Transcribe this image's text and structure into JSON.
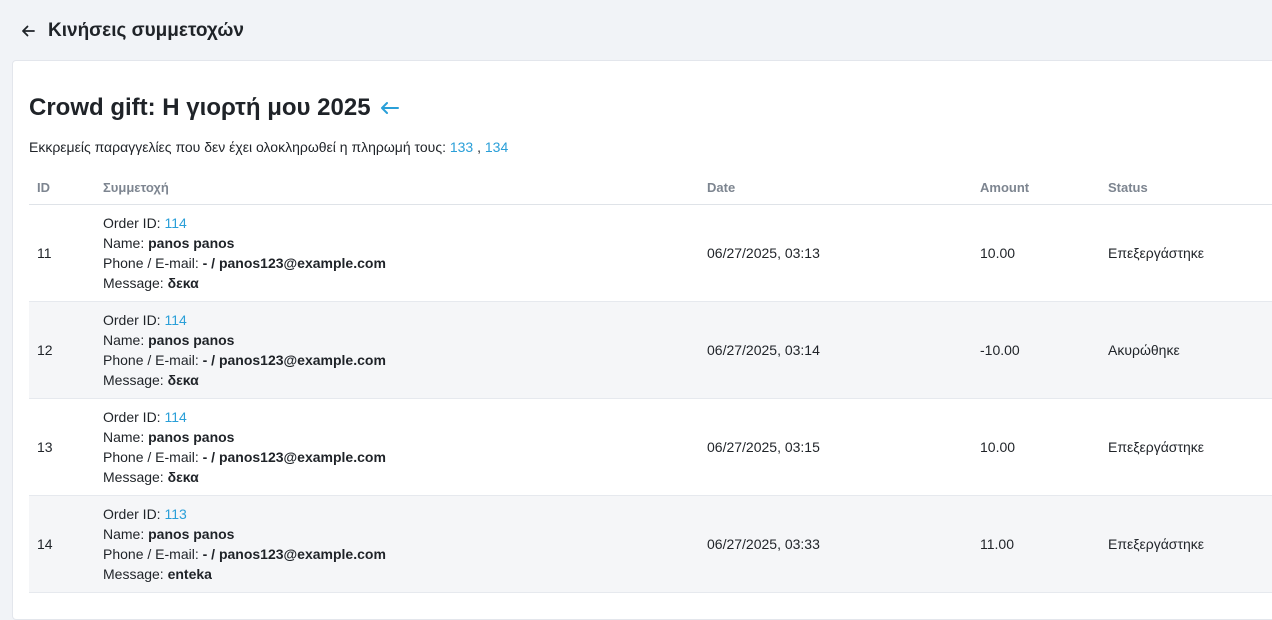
{
  "header": {
    "title": "Κινήσεις συμμετοχών"
  },
  "campaign": {
    "title": "Crowd gift: Η γιορτή μου 2025",
    "pending_text": "Εκκρεμείς παραγγελίες που δεν έχει ολοκληρωθεί η πληρωμή τους:",
    "pending_orders": [
      "133",
      "134"
    ],
    "pending_separator": ","
  },
  "table": {
    "columns": [
      "ID",
      "Συμμετοχή",
      "Date",
      "Amount",
      "Status"
    ],
    "labels": {
      "order_id": "Order ID:",
      "name": "Name:",
      "contact": "Phone / E-mail:",
      "message": "Message:"
    },
    "rows": [
      {
        "id": "11",
        "order_id": "114",
        "name": "panos panos",
        "contact": "- / panos123@example.com",
        "message": "δεκα",
        "date": "06/27/2025, 03:13",
        "amount": "10.00",
        "status": "Επεξεργάστηκε"
      },
      {
        "id": "12",
        "order_id": "114",
        "name": "panos panos",
        "contact": "- / panos123@example.com",
        "message": "δεκα",
        "date": "06/27/2025, 03:14",
        "amount": "-10.00",
        "status": "Ακυρώθηκε"
      },
      {
        "id": "13",
        "order_id": "114",
        "name": "panos panos",
        "contact": "- / panos123@example.com",
        "message": "δεκα",
        "date": "06/27/2025, 03:15",
        "amount": "10.00",
        "status": "Επεξεργάστηκε"
      },
      {
        "id": "14",
        "order_id": "113",
        "name": "panos panos",
        "contact": "- / panos123@example.com",
        "message": "enteka",
        "date": "06/27/2025, 03:33",
        "amount": "11.00",
        "status": "Επεξεργάστηκε"
      }
    ]
  },
  "icons": {
    "back": "arrow-left-icon",
    "heading_link": "arrow-left-icon"
  },
  "colors": {
    "link": "#2a9fd8",
    "background": "#f1f3f7",
    "row_alt": "#f5f6f8"
  }
}
